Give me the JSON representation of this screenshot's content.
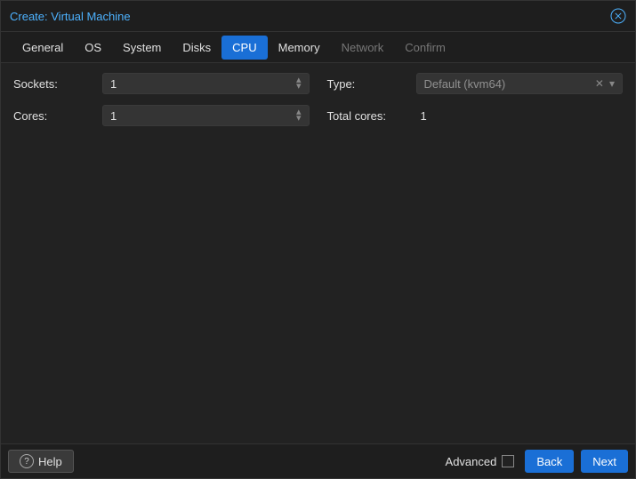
{
  "title": "Create: Virtual Machine",
  "tabs": [
    {
      "label": "General",
      "state": "enabled"
    },
    {
      "label": "OS",
      "state": "enabled"
    },
    {
      "label": "System",
      "state": "enabled"
    },
    {
      "label": "Disks",
      "state": "enabled"
    },
    {
      "label": "CPU",
      "state": "active"
    },
    {
      "label": "Memory",
      "state": "enabled"
    },
    {
      "label": "Network",
      "state": "disabled"
    },
    {
      "label": "Confirm",
      "state": "disabled"
    }
  ],
  "left": {
    "sockets": {
      "label": "Sockets:",
      "value": "1"
    },
    "cores": {
      "label": "Cores:",
      "value": "1"
    }
  },
  "right": {
    "type": {
      "label": "Type:",
      "value": "Default (kvm64)"
    },
    "total_cores": {
      "label": "Total cores:",
      "value": "1"
    }
  },
  "footer": {
    "help": "Help",
    "advanced": "Advanced",
    "advanced_checked": false,
    "back": "Back",
    "next": "Next"
  }
}
